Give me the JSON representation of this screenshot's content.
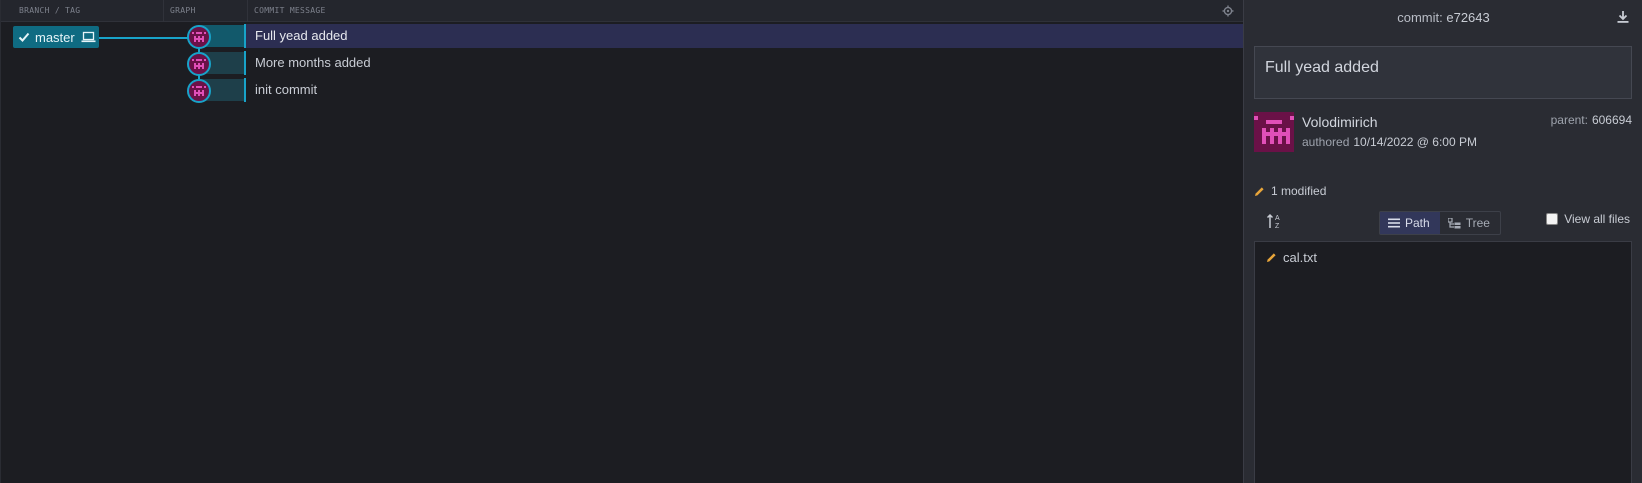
{
  "graph": {
    "headers": {
      "branch": "BRANCH / TAG",
      "graph": "GRAPH",
      "message": "COMMIT MESSAGE"
    },
    "branch_label": "master",
    "commits": [
      {
        "message": "Full yead added",
        "selected": true
      },
      {
        "message": "More months added",
        "selected": false
      },
      {
        "message": "init commit",
        "selected": false
      }
    ]
  },
  "detail": {
    "commit_label": "commit:",
    "commit_sha": "e72643",
    "message": "Full yead added",
    "author": "Volodimirich",
    "authored_label": "authored",
    "authored_date": "10/14/2022 @ 6:00 PM",
    "parent_label": "parent:",
    "parent_sha": "606694",
    "modified_count": "1 modified",
    "view_path": "Path",
    "view_tree": "Tree",
    "view_all_files": "View all files",
    "files": [
      "cal.txt"
    ]
  },
  "colors": {
    "accent": "#18a3c9",
    "avatar_pink": "#e14fb8",
    "avatar_bg": "#6a1147",
    "pencil": "#e8a53a"
  },
  "icons": [
    "settings-icon",
    "check-icon",
    "laptop-icon",
    "download-icon",
    "pencil-icon",
    "sort-icon",
    "list-icon",
    "tree-icon"
  ]
}
